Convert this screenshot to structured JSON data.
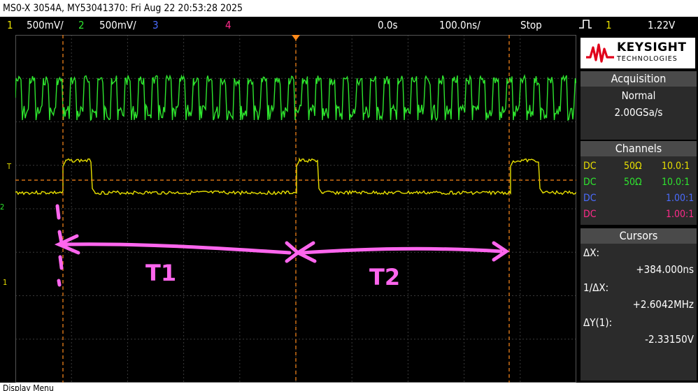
{
  "title": "MS0-X 3054A, MY53041370: Fri Aug 22 20:53:28 2025",
  "status": {
    "ch1_num": "1",
    "ch1_scale": "500mV/",
    "ch2_num": "2",
    "ch2_scale": "500mV/",
    "ch3_num": "3",
    "ch4_num": "4",
    "time_offset": "0.0s",
    "time_scale": "100.0ns/",
    "run_state": "Stop",
    "trigger_source": "1",
    "trigger_level": "1.22V"
  },
  "logo": {
    "brand": "KEYSIGHT",
    "sub": "TECHNOLOGIES"
  },
  "acquisition": {
    "header": "Acquisition",
    "mode": "Normal",
    "rate": "2.00GSa/s"
  },
  "channels": {
    "header": "Channels",
    "rows": [
      {
        "coupling": "DC",
        "impedance": "50Ω",
        "probe": "10.0:1",
        "color": "#e8e000"
      },
      {
        "coupling": "DC",
        "impedance": "50Ω",
        "probe": "10.0:1",
        "color": "#2ee62e"
      },
      {
        "coupling": "DC",
        "impedance": "",
        "probe": "1.00:1",
        "color": "#4a6cff"
      },
      {
        "coupling": "DC",
        "impedance": "",
        "probe": "1.00:1",
        "color": "#ff2a8a"
      }
    ]
  },
  "cursors": {
    "header": "Cursors",
    "dx_label": "ΔX:",
    "dx_value": "+384.000ns",
    "inv_dx_label": "1/ΔX:",
    "inv_dx_value": "+2.6042MHz",
    "dy_label": "ΔY(1):",
    "dy_value": "-2.33150V"
  },
  "annotations": {
    "t1": "T1",
    "t2": "T2"
  },
  "markers": {
    "trigger": "T",
    "ch2": "2",
    "ch1": "1"
  },
  "message": "Display Menu",
  "colors": {
    "ch1": "#e8e000",
    "ch2": "#2ee62e",
    "ch3": "#4a6cff",
    "ch4": "#ff2a8a",
    "cursor": "#ff8a1a",
    "annotation": "#ff66ee",
    "grid": "#3a3a3a"
  }
}
